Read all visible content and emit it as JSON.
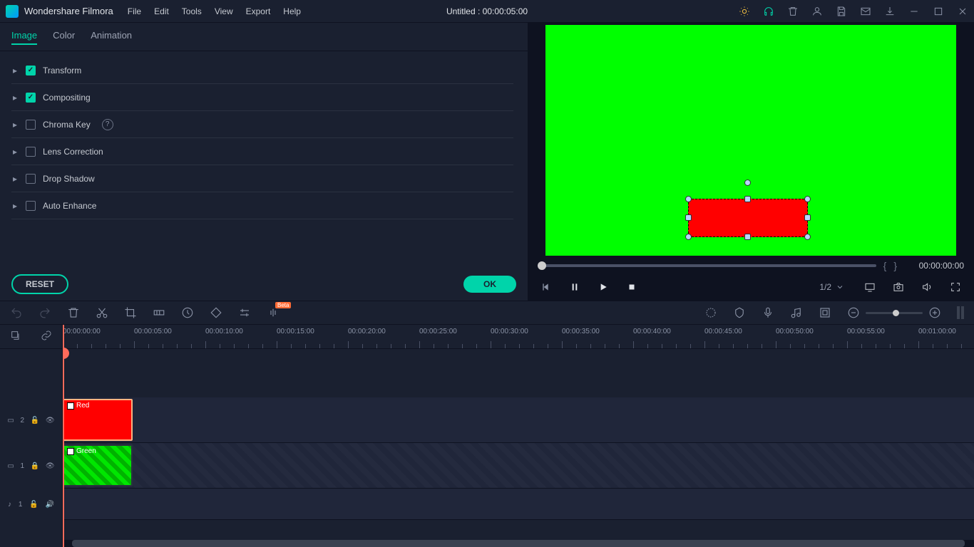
{
  "app": {
    "name": "Wondershare Filmora",
    "title": "Untitled : 00:00:05:00"
  },
  "menu": [
    "File",
    "Edit",
    "Tools",
    "View",
    "Export",
    "Help"
  ],
  "panel": {
    "tabs": [
      "Image",
      "Color",
      "Animation"
    ],
    "active_tab": 0,
    "props": [
      {
        "label": "Transform",
        "checked": true,
        "help": false
      },
      {
        "label": "Compositing",
        "checked": true,
        "help": false
      },
      {
        "label": "Chroma Key",
        "checked": false,
        "help": true
      },
      {
        "label": "Lens Correction",
        "checked": false,
        "help": false
      },
      {
        "label": "Drop Shadow",
        "checked": false,
        "help": false
      },
      {
        "label": "Auto Enhance",
        "checked": false,
        "help": false
      }
    ],
    "reset": "RESET",
    "ok": "OK"
  },
  "preview": {
    "scrub_tc": "00:00:00:00",
    "zoom": "1/2"
  },
  "toolbar": {
    "beta": "Beta"
  },
  "timeline": {
    "marks": [
      "00:00:00:00",
      "00:00:05:00",
      "00:00:10:00",
      "00:00:15:00",
      "00:00:20:00",
      "00:00:25:00",
      "00:00:30:00",
      "00:00:35:00",
      "00:00:40:00",
      "00:00:45:00",
      "00:00:50:00",
      "00:00:55:00",
      "00:01:00:00"
    ],
    "tracks": {
      "v2": {
        "id": "2",
        "clip": "Red"
      },
      "v1": {
        "id": "1",
        "clip": "Green"
      },
      "a1": {
        "id": "1"
      }
    }
  }
}
